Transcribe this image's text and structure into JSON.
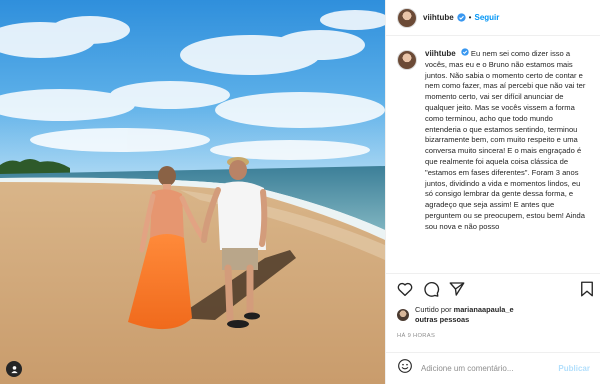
{
  "header": {
    "username": "viihtube",
    "follow_label": "Seguir",
    "dot": "•"
  },
  "caption": {
    "username": "viihtube",
    "text": "Eu nem sei como dizer isso a vocês, mas eu e o Bruno não estamos mais juntos. Não sabia o momento certo de contar e nem como fazer, mas aí percebi que não vai ter momento certo, vai ser difícil anunciar de qualquer jeito. Mas se vocês vissem a forma como terminou, acho que todo mundo entenderia o que estamos sentindo, terminou bizarramente bem, com muito respeito e uma conversa muito sincera! E o mais engraçado é que realmente foi aquela coisa clássica de \"estamos em fases diferentes\". Foram 3 anos juntos, dividindo a vida e momentos lindos, eu só consigo lembrar da gente dessa forma, e agradeço que seja assim! E antes que perguntem ou se preocupem, estou bem! Ainda sou nova e não posso"
  },
  "likes": {
    "prefix": "Curtido por",
    "user": "marianaapaula_e",
    "suffix": "outras pessoas"
  },
  "timestamp": "HÁ 9 HORAS",
  "comment": {
    "placeholder": "Adicione um comentário...",
    "publish_label": "Publicar"
  },
  "icons": {
    "like": "heart-icon",
    "comment": "comment-icon",
    "share": "share-icon",
    "save": "bookmark-icon",
    "emoji": "emoji-icon",
    "verified": "verified-badge-icon",
    "tags": "user-tag-icon"
  },
  "colors": {
    "accent": "#0095f6",
    "verified": "#3897f0",
    "publish_disabled": "#b2dffc",
    "muted": "#8e8e8e"
  }
}
